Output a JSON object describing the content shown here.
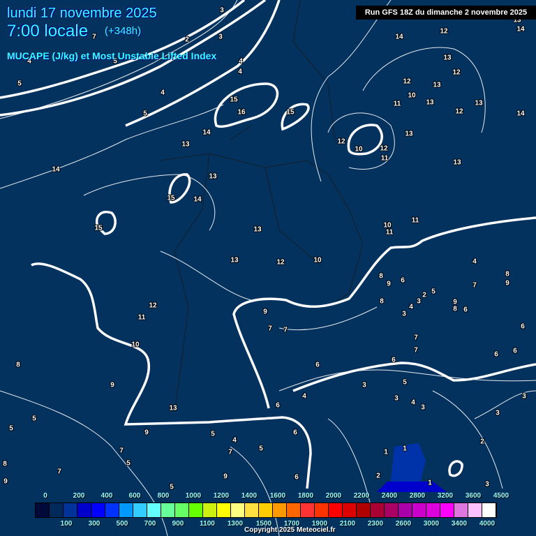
{
  "header": {
    "date": "lundi 17 novembre 2025",
    "time": "7:00 locale",
    "lead": "(+348h)",
    "subtitle": "MUCAPE (J/kg) et Most Unstable Lifted Index",
    "run": "Run GFS 18Z du dimanche 2 novembre 2025"
  },
  "colorbar": {
    "colors": [
      "#000a3a",
      "#002a5a",
      "#003399",
      "#0000cc",
      "#0000ff",
      "#0033ff",
      "#0099ff",
      "#33ccff",
      "#66ffff",
      "#66ff99",
      "#66ff66",
      "#66ff00",
      "#ccf010",
      "#ffff00",
      "#ffff80",
      "#ffe040",
      "#ffcc00",
      "#ff9900",
      "#ff6600",
      "#ff3333",
      "#ff3300",
      "#ff0000",
      "#dd0000",
      "#b00000",
      "#aa0033",
      "#aa0066",
      "#aa00aa",
      "#cc00cc",
      "#dd00dd",
      "#ff00ff",
      "#dd77dd",
      "#ffc0ff",
      "#ffffff"
    ],
    "top_labels": [
      "0",
      "200",
      "400",
      "600",
      "800",
      "1000",
      "1200",
      "1400",
      "1600",
      "1800",
      "2000",
      "2200",
      "2400",
      "2800",
      "3200",
      "3600",
      "4500"
    ],
    "bottom_labels": [
      "100",
      "300",
      "500",
      "700",
      "900",
      "1100",
      "1300",
      "1500",
      "1700",
      "1900",
      "2100",
      "2300",
      "2600",
      "3000",
      "3400",
      "4000"
    ]
  },
  "lifted_index_labels": [
    "3",
    "3",
    "2",
    "7",
    "4",
    "5",
    "4",
    "4",
    "5",
    "4",
    "5",
    "15",
    "16",
    "15",
    "14",
    "13",
    "14",
    "13",
    "15",
    "14",
    "15",
    "13",
    "13",
    "12",
    "10",
    "10",
    "11",
    "11",
    "14",
    "12",
    "13",
    "14",
    "12",
    "10",
    "11",
    "13",
    "13",
    "13",
    "12",
    "13",
    "12",
    "14",
    "12",
    "10",
    "12",
    "11",
    "13",
    "13",
    "12",
    "11",
    "10",
    "9",
    "8",
    "13",
    "5",
    "5",
    "9",
    "7",
    "5",
    "9",
    "7",
    "7",
    "6",
    "4",
    "6",
    "5",
    "4",
    "7",
    "5",
    "6",
    "3",
    "3",
    "5",
    "4",
    "3",
    "8",
    "9",
    "6",
    "8",
    "3",
    "4",
    "2",
    "5",
    "3",
    "7",
    "7",
    "6",
    "9",
    "8",
    "6",
    "7",
    "4",
    "8",
    "9",
    "6",
    "6",
    "6",
    "3",
    "3",
    "2",
    "3",
    "1",
    "1",
    "1",
    "2",
    "6",
    "9",
    "5",
    "7",
    "9",
    "8"
  ],
  "copyright": "Copyright 2025 Meteociel.fr"
}
